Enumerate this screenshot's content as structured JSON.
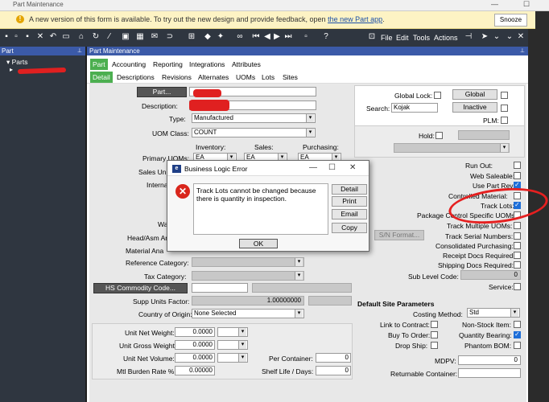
{
  "window": {
    "title": "Part Maintenance"
  },
  "banner": {
    "prefix": "A new version of this form is available. To try out the new design and provide feedback, open ",
    "link": "the new Part app",
    "suffix": ".",
    "snooze": "Snooze"
  },
  "menu": [
    "File",
    "Edit",
    "Tools",
    "Actions"
  ],
  "left_panel": {
    "title": "Part",
    "tree_root": "Parts"
  },
  "main_panel": {
    "title": "Part Maintenance"
  },
  "tabs_top": [
    "Part",
    "Accounting",
    "Reporting",
    "Integrations",
    "Attributes"
  ],
  "tabs_sub": [
    "Detail",
    "Descriptions",
    "Revisions",
    "Alternates",
    "UOMs",
    "Lots",
    "Sites"
  ],
  "form": {
    "part_btn": "Part...",
    "description_lbl": "Description:",
    "type_lbl": "Type:",
    "type_val": "Manufactured",
    "uom_class_lbl": "UOM Class:",
    "uom_class_val": "COUNT",
    "inventory_hdr": "Inventory:",
    "sales_hdr": "Sales:",
    "purchasing_hdr": "Purchasing:",
    "primary_uoms_lbl": "Primary UOMs:",
    "uom_ea": "EA",
    "sales_unit_lbl": "Sales Un",
    "internal_lbl": "Interna",
    "wa_lbl": "Wa",
    "head_asm_lbl": "Head/Asm Ar",
    "material_an_lbl": "Material Ana",
    "reference_cat_lbl": "Reference Category:",
    "tax_cat_lbl": "Tax Category:",
    "hs_btn": "HS Commodity Code...",
    "supp_units_lbl": "Supp Units Factor:",
    "supp_units_val": "1.00000000",
    "country_lbl": "Country of Origin:",
    "country_val": "None Selected",
    "unit_net_weight_lbl": "Unit Net Weight:",
    "unit_gross_weight_lbl": "Unit Gross Weight:",
    "unit_net_volume_lbl": "Unit Net Volume:",
    "zero4": "0.0000",
    "mtl_burden_lbl": "Mtl Burden Rate %:",
    "mtl_burden_val": "0.00000",
    "per_container_lbl": "Per Container:",
    "per_container_val": "0",
    "shelf_life_lbl": "Shelf Life / Days:",
    "shelf_life_val": "0"
  },
  "right": {
    "global_lock_lbl": "Global Lock:",
    "global_btn": "Global",
    "search_lbl": "Search:",
    "search_val": "Kojak",
    "inactive_btn": "Inactive",
    "plm_lbl": "PLM:",
    "hold_lbl": "Hold:",
    "run_out_lbl": "Run Out:",
    "web_saleable_lbl": "Web Saleable:",
    "use_part_rev_lbl": "Use Part Rev:",
    "controlled_material_lbl": "Controlled Material:",
    "track_lots_lbl": "Track Lots:",
    "package_control_lbl": "Package Control Specific UOMs:",
    "track_multiple_uoms_lbl": "Track Multiple UOMs:",
    "sn_format_btn": "S/N Format...",
    "track_serial_lbl": "Track Serial Numbers:",
    "consolidated_purchasing_lbl": "Consolidated Purchasing:",
    "receipt_docs_lbl": "Receipt Docs Required:",
    "shipping_docs_lbl": "Shipping Docs Required:",
    "sub_level_code_lbl": "Sub Level Code:",
    "sub_level_code_val": "0",
    "service_lbl": "Service:",
    "default_site_hdr": "Default Site Parameters",
    "costing_method_lbl": "Costing Method:",
    "costing_method_val": "Std",
    "link_to_contract_lbl": "Link to Contract:",
    "non_stock_lbl": "Non-Stock Item:",
    "buy_to_order_lbl": "Buy To Order:",
    "quantity_bearing_lbl": "Quantity Bearing:",
    "drop_ship_lbl": "Drop Ship:",
    "phantom_bom_lbl": "Phantom BOM:",
    "mdpv_lbl": "MDPV:",
    "mdpv_val": "0",
    "returnable_container_lbl": "Returnable Container:"
  },
  "dialog": {
    "title": "Business Logic Error",
    "message": "Track Lots cannot be changed because there is quantity in inspection.",
    "detail": "Detail",
    "print": "Print",
    "email": "Email",
    "copy": "Copy",
    "ok": "OK"
  },
  "colors": {
    "accent_green": "#4caf50",
    "header_blue": "#3b5aa8",
    "checkbox_blue": "#1e6fd9",
    "annotation_red": "#e52020"
  }
}
